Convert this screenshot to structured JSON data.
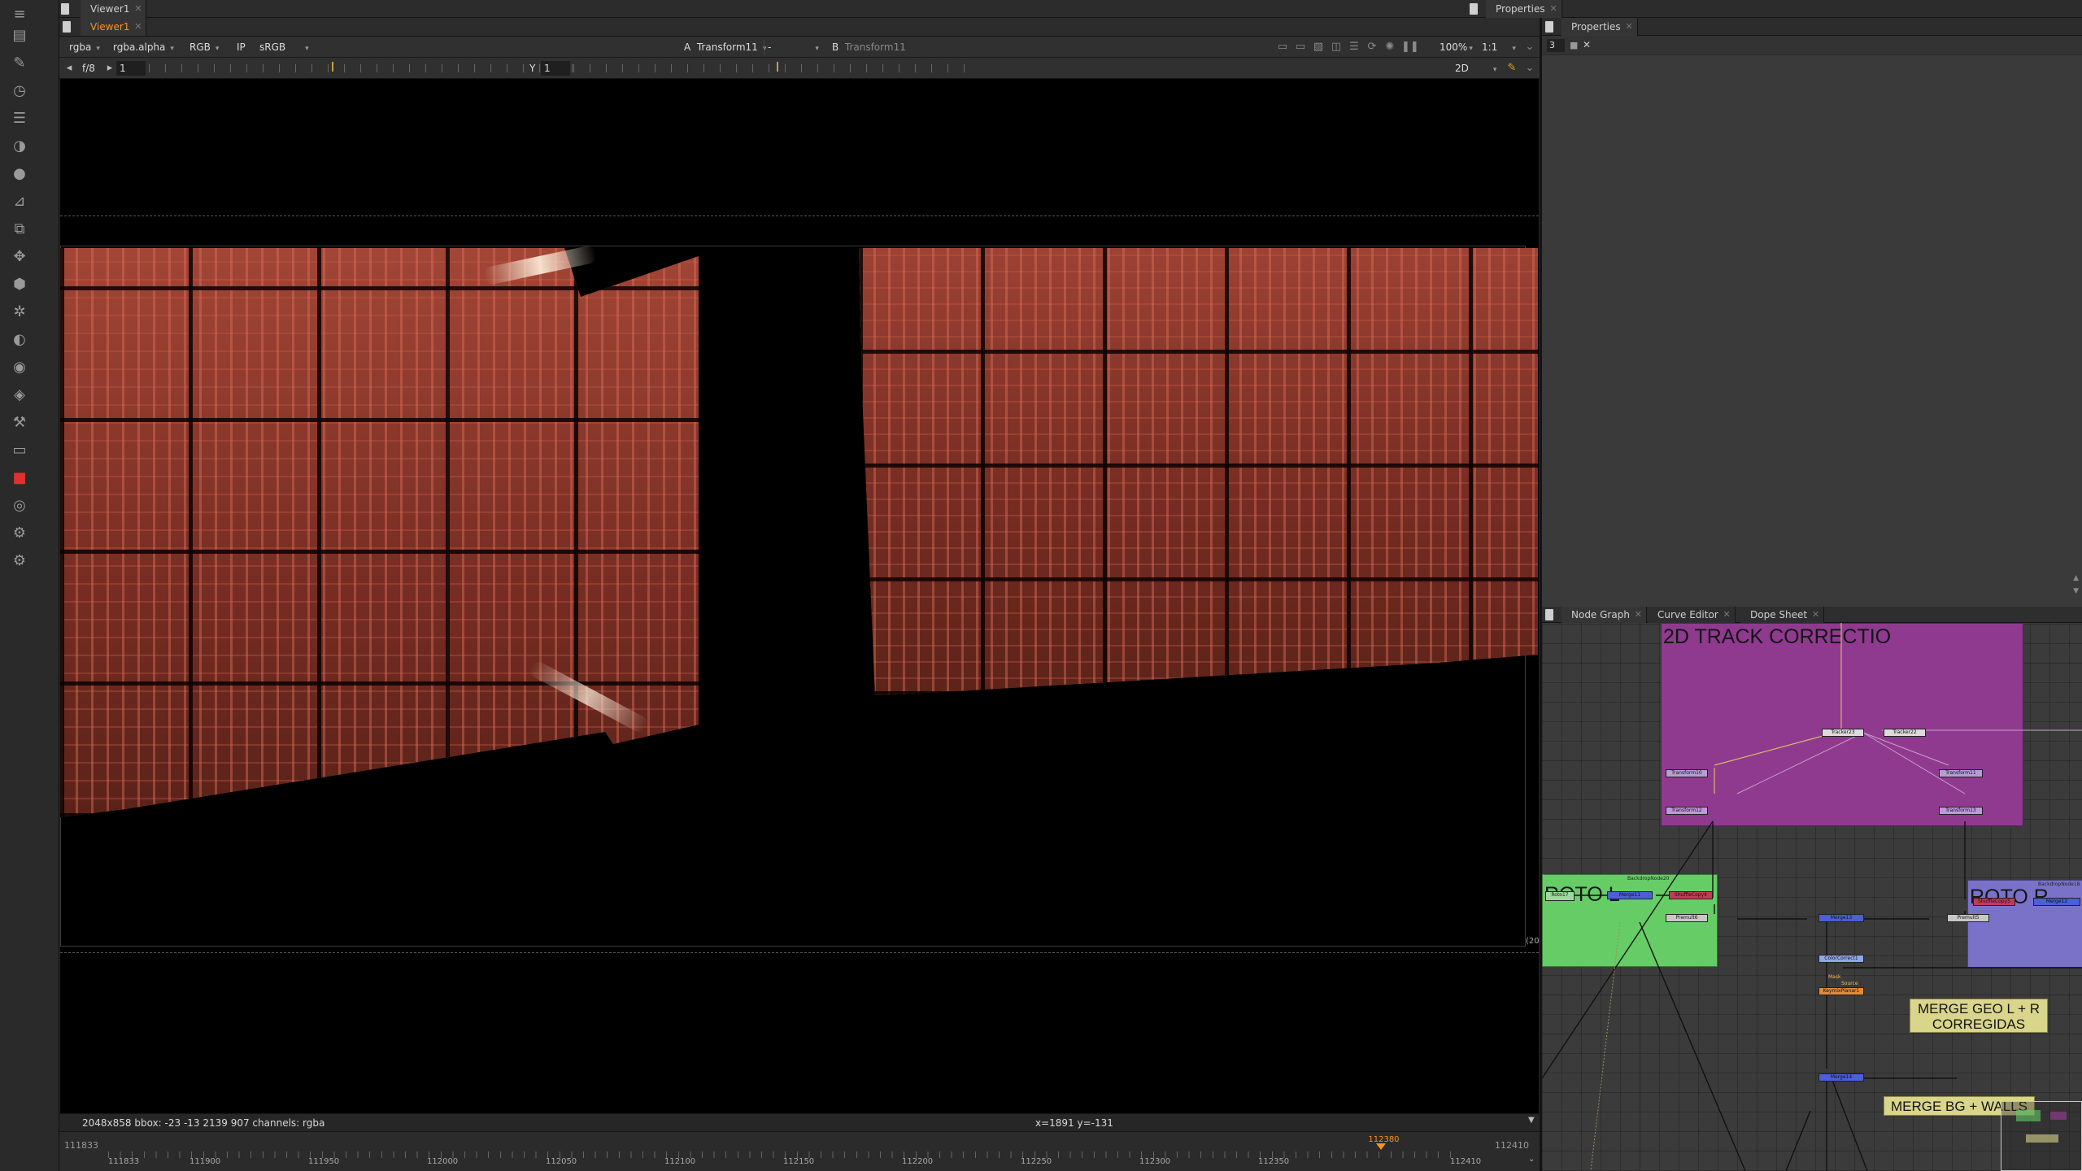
{
  "viewer_panel": {
    "outer_tab": "Viewer1",
    "inner_tab": "Viewer1",
    "channels": "rgba",
    "alpha_channel": "rgba.alpha",
    "display_mode": "RGB",
    "ip_label": "IP",
    "lut": "sRGB",
    "input_a_label": "A",
    "input_a": "Transform11",
    "wipe": "-",
    "input_b_label": "B",
    "input_b": "Transform11",
    "zoom": "100%",
    "proxy": "1:1",
    "fstop": "f/8",
    "gain_value": "1",
    "gamma_label": "Y",
    "gamma_value": "1",
    "view_mode": "2D",
    "format_info": "2048x858  bbox: -23 -13 2139 907 channels: rgba",
    "cursor_info": "x=1891 y=-131",
    "edge_label": "(20"
  },
  "timeline": {
    "start": "111833",
    "end": "112410",
    "in_frame": "111833",
    "out_frame": "112410",
    "current_frame": "112380",
    "current_fraction": 0.943,
    "labels": [
      "111900",
      "111950",
      "112000",
      "112050",
      "112100",
      "112150",
      "112200",
      "112250",
      "112300",
      "112350"
    ]
  },
  "properties": {
    "outer_tab": "Properties",
    "inner_tab": "Properties",
    "max_panels": "3"
  },
  "node_graph": {
    "tabs": [
      "Node Graph",
      "Curve Editor",
      "Dope Sheet"
    ],
    "backdrops": {
      "track": "2D TRACK CORRECTIO",
      "roto_l": "ROTO L",
      "roto_l_small": "BackdropNode20",
      "roto_r": "ROTO R",
      "roto_r_small": "BackdropNode18"
    },
    "stickies": {
      "merge_geo": "MERGE GEO L + R CORREGIDAS",
      "merge_bg": "MERGE BG + WALLS"
    },
    "node_labels": {
      "tracker_a": "Tracker23",
      "tracker_b": "Tracker22",
      "transform_a": "Transform10",
      "transform_b": "Transform11",
      "transform_c": "Transform12",
      "transform_d": "Transform13",
      "roto_l": "Roto17",
      "shuffle_l": "ShuffleCopy4",
      "premult_l": "Premult6",
      "merge_l": "Merge11",
      "shuffle_r": "ShuffleCopy5",
      "merge_r": "Merge12",
      "premult_r": "Premult5",
      "merge_geo": "Merge13",
      "grade": "ColorCorrect1",
      "keymix": "KeymixPlanar1",
      "merge_bg": "Merge14",
      "mask_label": "Mask",
      "source_label": "Source"
    }
  },
  "colors": {
    "accent": "#f7931e",
    "track_backdrop": "#8f3a8f",
    "roto_l_backdrop": "#66cc66",
    "roto_r_backdrop": "#7a72c8",
    "sticky": "#d9d58a"
  }
}
